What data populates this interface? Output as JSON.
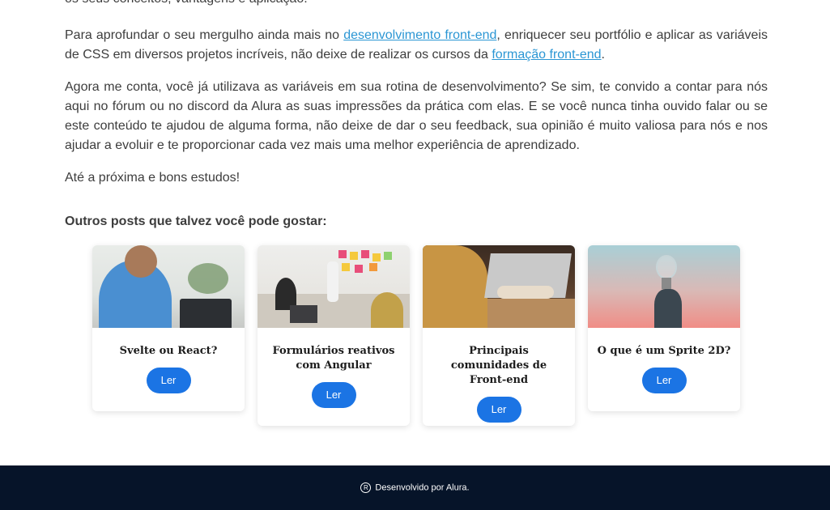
{
  "article": {
    "cut_line": "os seus conceitos, vantagens e aplicação.",
    "p1": {
      "before": "Para aprofundar o seu mergulho ainda mais no ",
      "link1": "desenvolvimento front-end",
      "middle": ", enriquecer seu portfólio e aplicar as variáveis de CSS em diversos projetos incríveis, não deixe de realizar os cursos da ",
      "link2": "formação front-end",
      "after": "."
    },
    "p2": "Agora me conta, você já utilizava as variáveis em sua rotina de desenvolvimento? Se sim, te convido a contar para nós aqui no fórum ou no discord da Alura as suas impressões da prática com elas. E se você nunca tinha ouvido falar ou se este conteúdo te ajudou de alguma forma, não deixe de dar o seu feedback, sua opinião é muito valiosa para nós e nos ajudar a evoluir e te proporcionar cada vez mais uma melhor experiência de aprendizado.",
    "p3": "Até a próxima e bons estudos!"
  },
  "related": {
    "title": "Outros posts que talvez você pode gostar:",
    "cards": [
      {
        "title": "Svelte ou React?",
        "button": "Ler"
      },
      {
        "title": "Formulários reativos com Angular",
        "button": "Ler"
      },
      {
        "title": "Principais comunidades de Front-end",
        "button": "Ler"
      },
      {
        "title": "O que é um Sprite 2D?",
        "button": "Ler"
      }
    ]
  },
  "footer": {
    "symbol": "R",
    "text": "Desenvolvido por Alura."
  },
  "colors": {
    "link": "#2b96d4",
    "button": "#1b74e4",
    "footer_bg": "#061429"
  }
}
